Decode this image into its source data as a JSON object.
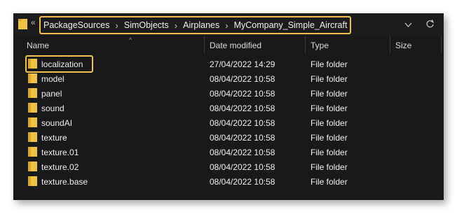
{
  "address": {
    "overflow": "«",
    "crumbs": [
      "PackageSources",
      "SimObjects",
      "Airplanes",
      "MyCompany_Simple_Aircraft"
    ],
    "separator": "›",
    "dropdown_icon": "chevron-down-icon",
    "refresh_icon": "refresh-icon",
    "highlight_color": "#f2c14b"
  },
  "columns": {
    "name": "Name",
    "date": "Date modified",
    "type": "Type",
    "size": "Size"
  },
  "rows": [
    {
      "name": "localization",
      "date": "27/04/2022 14:29",
      "type": "File folder",
      "size": ""
    },
    {
      "name": "model",
      "date": "08/04/2022 10:58",
      "type": "File folder",
      "size": ""
    },
    {
      "name": "panel",
      "date": "08/04/2022 10:58",
      "type": "File folder",
      "size": ""
    },
    {
      "name": "sound",
      "date": "08/04/2022 10:58",
      "type": "File folder",
      "size": ""
    },
    {
      "name": "soundAI",
      "date": "08/04/2022 10:58",
      "type": "File folder",
      "size": ""
    },
    {
      "name": "texture",
      "date": "08/04/2022 10:58",
      "type": "File folder",
      "size": ""
    },
    {
      "name": "texture.01",
      "date": "08/04/2022 10:58",
      "type": "File folder",
      "size": ""
    },
    {
      "name": "texture.02",
      "date": "08/04/2022 10:58",
      "type": "File folder",
      "size": ""
    },
    {
      "name": "texture.base",
      "date": "08/04/2022 10:58",
      "type": "File folder",
      "size": ""
    }
  ],
  "folder_color": "#f0c244"
}
